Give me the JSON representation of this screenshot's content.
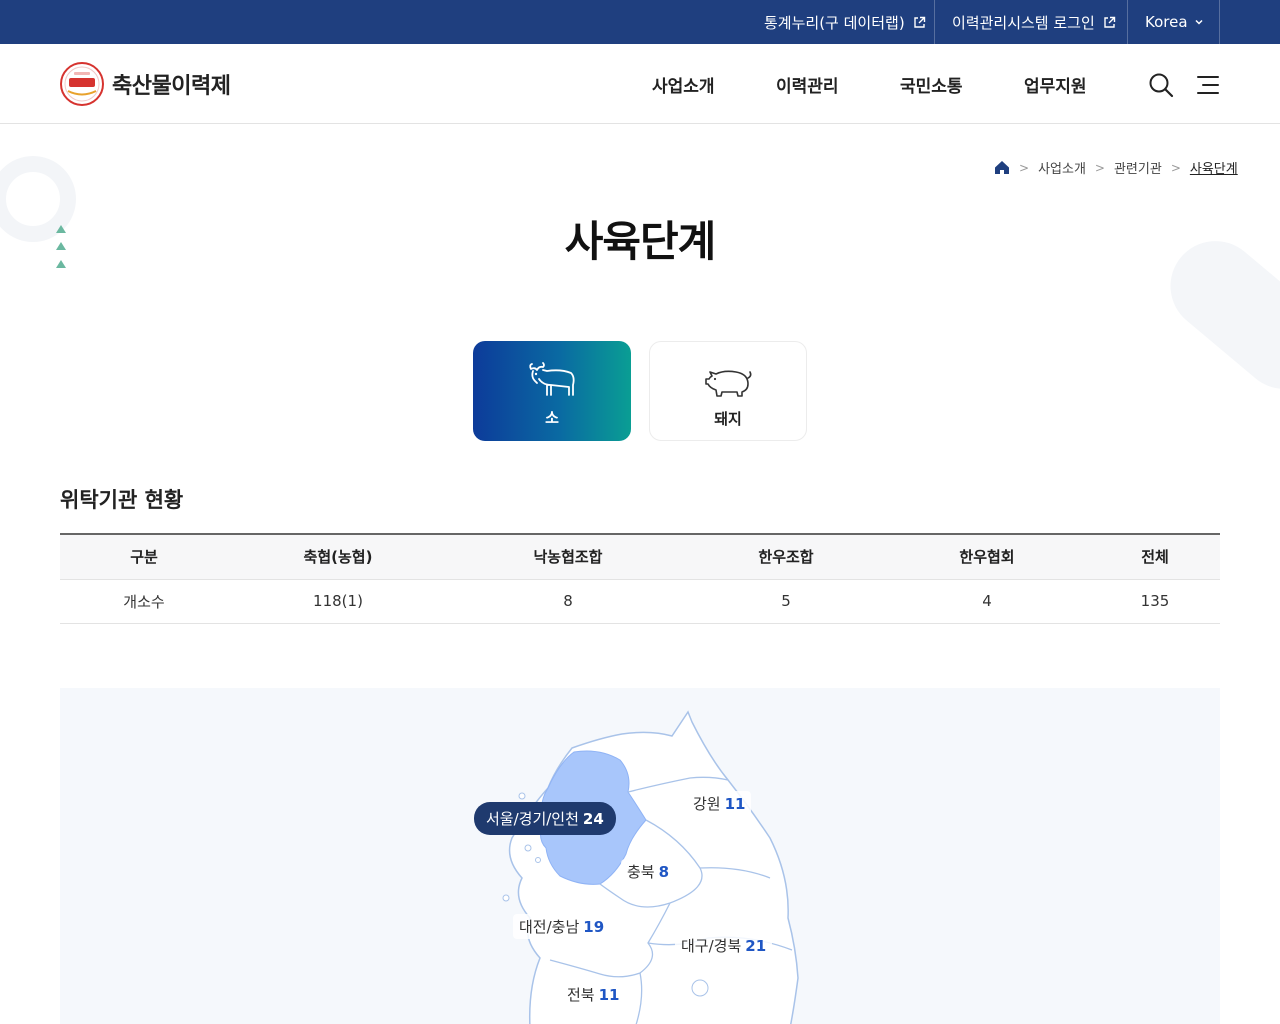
{
  "topbar": {
    "links": [
      {
        "label": "통계누리(구 데이터랩)"
      },
      {
        "label": "이력관리시스템 로그인"
      }
    ],
    "language": "Korea"
  },
  "header": {
    "brand": "축산물이력제",
    "nav": [
      "사업소개",
      "이력관리",
      "국민소통",
      "업무지원"
    ]
  },
  "breadcrumb": [
    "사업소개",
    "관련기관",
    "사육단계"
  ],
  "page": {
    "title": "사육단계"
  },
  "tabs": [
    {
      "label": "소",
      "icon": "cow-icon",
      "active": true
    },
    {
      "label": "돼지",
      "icon": "pig-icon",
      "active": false
    }
  ],
  "section": {
    "title": "위탁기관 현황"
  },
  "table": {
    "headers": [
      "구분",
      "축협(농협)",
      "낙농협조합",
      "한우조합",
      "한우협회",
      "전체"
    ],
    "rows": [
      [
        "개소수",
        "118(1)",
        "8",
        "5",
        "4",
        "135"
      ]
    ]
  },
  "map": {
    "regions": [
      {
        "name": "서울/경기/인천",
        "count": "24",
        "selected": true
      },
      {
        "name": "강원",
        "count": "11",
        "selected": false
      },
      {
        "name": "충북",
        "count": "8",
        "selected": false
      },
      {
        "name": "대전/충남",
        "count": "19",
        "selected": false
      },
      {
        "name": "대구/경북",
        "count": "21",
        "selected": false
      },
      {
        "name": "전북",
        "count": "11",
        "selected": false
      }
    ]
  },
  "colors": {
    "topbar": "#1f3f7f",
    "accent": "#1f56c4",
    "tab_gradient_start": "#0d3b9a",
    "tab_gradient_end": "#0a9e94",
    "selected_region": "#a8c6fb"
  }
}
